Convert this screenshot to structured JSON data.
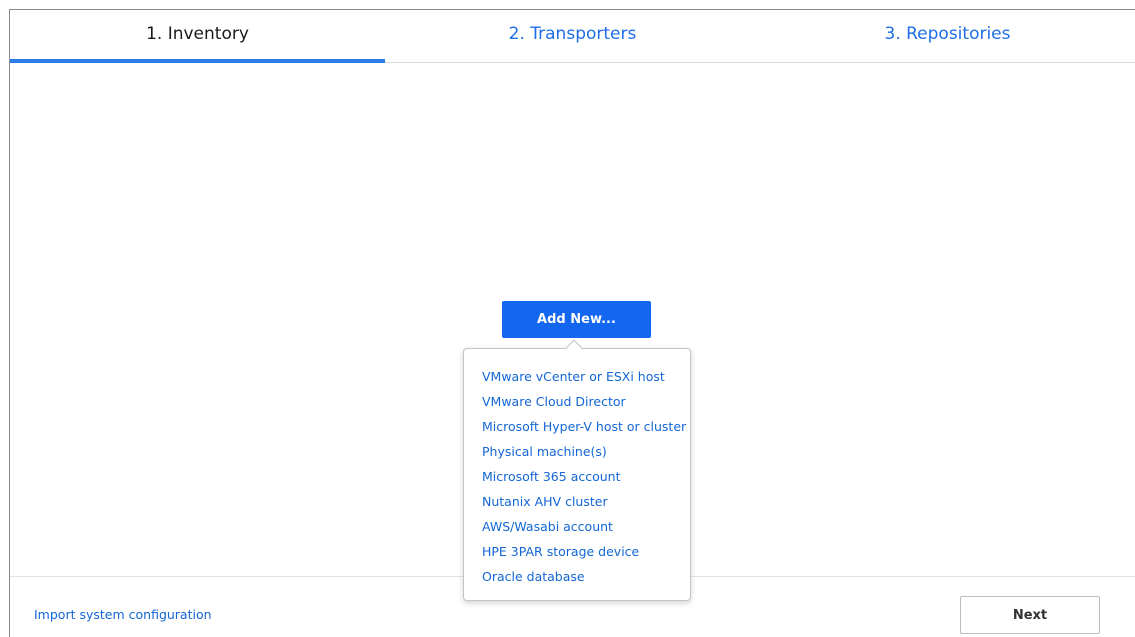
{
  "tabs": [
    {
      "label": "1. Inventory",
      "active": true
    },
    {
      "label": "2. Transporters",
      "active": false
    },
    {
      "label": "3. Repositories",
      "active": false
    }
  ],
  "main": {
    "add_button_label": "Add New..."
  },
  "add_menu": {
    "items": [
      "VMware vCenter or ESXi host",
      "VMware Cloud Director",
      "Microsoft Hyper-V host or cluster",
      "Physical machine(s)",
      "Microsoft 365 account",
      "Nutanix AHV cluster",
      "AWS/Wasabi account",
      "HPE 3PAR storage device",
      "Oracle database"
    ]
  },
  "footer": {
    "import_link": "Import system configuration",
    "next_label": "Next"
  },
  "colors": {
    "accent": "#1366f0",
    "link": "#1366d6",
    "tab_underline": "#2b7be8"
  }
}
